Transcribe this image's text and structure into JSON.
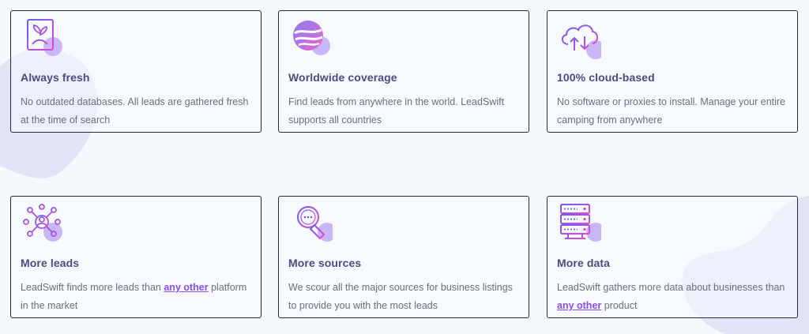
{
  "features": [
    {
      "icon": "sprout-icon",
      "title": "Always fresh",
      "desc": "No outdated databases. All leads are gathered fresh at the time of search"
    },
    {
      "icon": "globe-icon",
      "title": "Worldwide coverage",
      "desc": "Find leads from anywhere in the world. LeadSwift supports all countries"
    },
    {
      "icon": "cloud-upload-icon",
      "title": "100% cloud-based",
      "desc": "No software or proxies to install. Manage your entire camping from anywhere"
    },
    {
      "icon": "network-user-icon",
      "title": "More leads",
      "desc_before": "LeadSwift finds more leads than ",
      "link": "any other",
      "desc_after": " platform in the market"
    },
    {
      "icon": "magnifier-icon",
      "title": "More sources",
      "desc": "We scour all the major sources for business listings to provide you with the most leads"
    },
    {
      "icon": "server-stack-icon",
      "title": "More data",
      "desc_before": "LeadSwift gathers more data about businesses than ",
      "link": "any other",
      "desc_after": " product"
    }
  ],
  "colors": {
    "title": "#4b4a86",
    "text": "#6d6d80",
    "link": "#8a4cf0",
    "accent_blob": "#c8b6f6",
    "bg_blob": "#e4e5f6"
  }
}
